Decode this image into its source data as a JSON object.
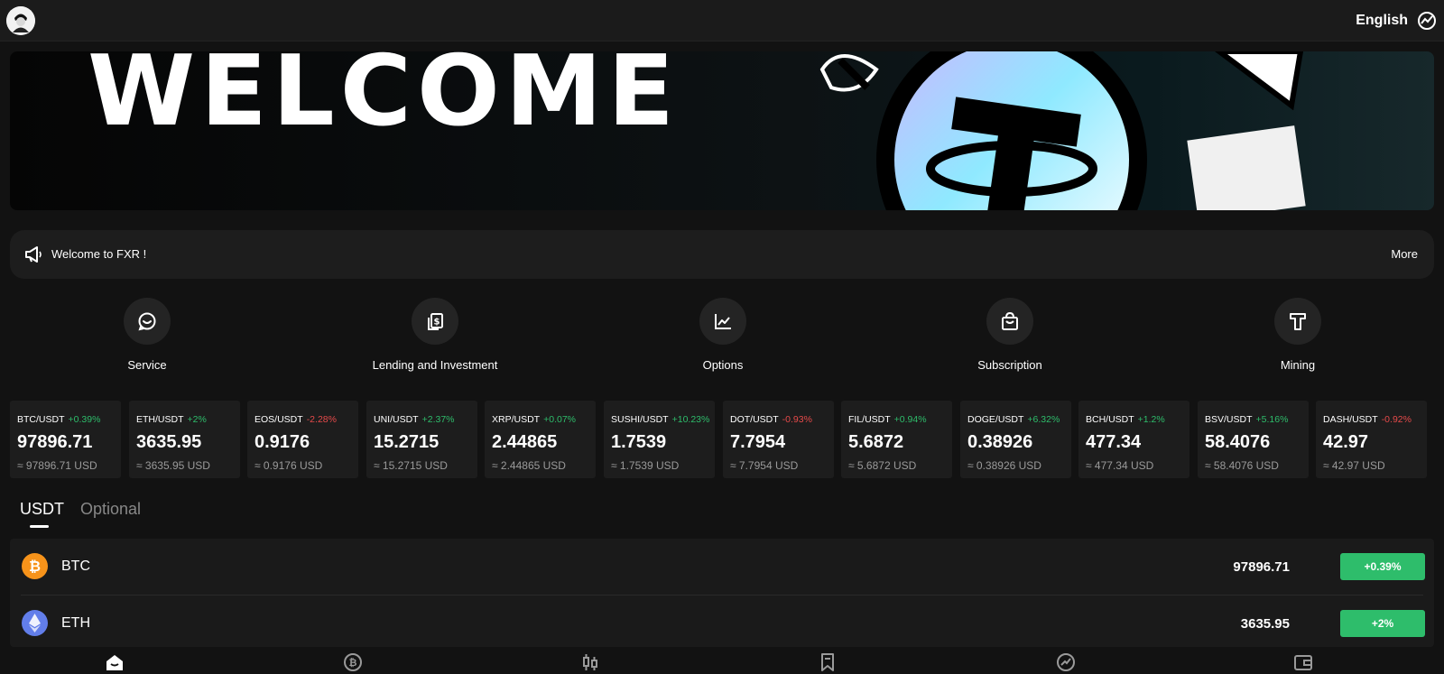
{
  "header": {
    "language": "English",
    "avatar_icon": "user-avatar-icon",
    "language_icon": "globe-icon"
  },
  "banner": {
    "text": "WELCOME"
  },
  "notice": {
    "icon": "megaphone-icon",
    "text": "Welcome to FXR !",
    "more_label": "More"
  },
  "quick_menu": [
    {
      "label": "Service",
      "icon": "chat-icon"
    },
    {
      "label": "Lending and Investment",
      "icon": "document-dollar-icon"
    },
    {
      "label": "Options",
      "icon": "chart-line-icon"
    },
    {
      "label": "Subscription",
      "icon": "shopping-bag-icon"
    },
    {
      "label": "Mining",
      "icon": "tether-icon"
    }
  ],
  "tickers": [
    {
      "pair": "BTC/USDT",
      "change": "+0.39%",
      "price": "97896.71",
      "usd": "≈ 97896.71 USD",
      "direction": "up"
    },
    {
      "pair": "ETH/USDT",
      "change": "+2%",
      "price": "3635.95",
      "usd": "≈ 3635.95 USD",
      "direction": "up"
    },
    {
      "pair": "EOS/USDT",
      "change": "-2.28%",
      "price": "0.9176",
      "usd": "≈ 0.9176 USD",
      "direction": "down"
    },
    {
      "pair": "UNI/USDT",
      "change": "+2.37%",
      "price": "15.2715",
      "usd": "≈ 15.2715 USD",
      "direction": "up"
    },
    {
      "pair": "XRP/USDT",
      "change": "+0.07%",
      "price": "2.44865",
      "usd": "≈ 2.44865 USD",
      "direction": "up"
    },
    {
      "pair": "SUSHI/USDT",
      "change": "+10.23%",
      "price": "1.7539",
      "usd": "≈ 1.7539 USD",
      "direction": "up"
    },
    {
      "pair": "DOT/USDT",
      "change": "-0.93%",
      "price": "7.7954",
      "usd": "≈ 7.7954 USD",
      "direction": "down"
    },
    {
      "pair": "FIL/USDT",
      "change": "+0.94%",
      "price": "5.6872",
      "usd": "≈ 5.6872 USD",
      "direction": "up"
    },
    {
      "pair": "DOGE/USDT",
      "change": "+6.32%",
      "price": "0.38926",
      "usd": "≈ 0.38926 USD",
      "direction": "up"
    },
    {
      "pair": "BCH/USDT",
      "change": "+1.2%",
      "price": "477.34",
      "usd": "≈ 477.34 USD",
      "direction": "up"
    },
    {
      "pair": "BSV/USDT",
      "change": "+5.16%",
      "price": "58.4076",
      "usd": "≈ 58.4076 USD",
      "direction": "up"
    },
    {
      "pair": "DASH/USDT",
      "change": "-0.92%",
      "price": "42.97",
      "usd": "≈ 42.97 USD",
      "direction": "down"
    }
  ],
  "tabs": {
    "usdt": "USDT",
    "optional": "Optional"
  },
  "market": [
    {
      "name": "BTC",
      "price": "97896.71",
      "change": "+0.39%",
      "icon": "bitcoin-icon"
    },
    {
      "name": "ETH",
      "price": "3635.95",
      "change": "+2%",
      "icon": "ethereum-icon"
    }
  ],
  "bottom_nav": [
    {
      "icon": "home-icon"
    },
    {
      "icon": "bitcoin-circle-icon"
    },
    {
      "icon": "candlestick-icon"
    },
    {
      "icon": "bookmark-icon"
    },
    {
      "icon": "trend-icon"
    },
    {
      "icon": "wallet-icon"
    }
  ],
  "colors": {
    "up": "#2ebd6b",
    "down": "#e64a4a",
    "background": "#121212",
    "card": "#1d1d1d",
    "btc": "#f7931a",
    "eth": "#627eea"
  }
}
